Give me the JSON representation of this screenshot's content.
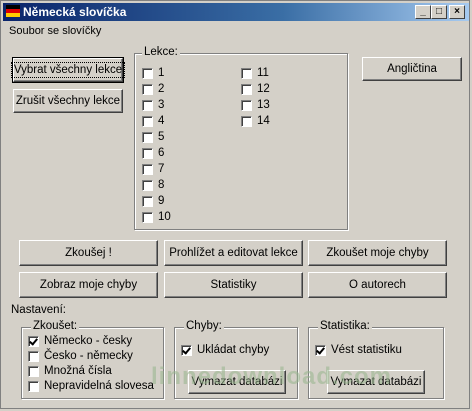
{
  "window": {
    "title": "Německá slovíčka"
  },
  "titlebar_buttons": {
    "minimize": "_",
    "maximize": "□",
    "close": "×"
  },
  "menu": {
    "file": "Soubor se slovíčky"
  },
  "left_buttons": {
    "select_all": "Vybrat všechny lekce",
    "cancel_all": "Zrušit všechny lekce"
  },
  "language_button": "Angličtina",
  "lessons": {
    "label": "Lekce:",
    "col1": [
      "1",
      "2",
      "3",
      "4",
      "5",
      "6",
      "7",
      "8",
      "9",
      "10"
    ],
    "col2": [
      "11",
      "12",
      "13",
      "14"
    ]
  },
  "actions": {
    "test": "Zkoušej !",
    "browse": "Prohlížet a editovat lekce",
    "test_mistakes": "Zkoušet moje chyby",
    "show_mistakes": "Zobraz moje chyby",
    "statistics": "Statistiky",
    "about": "O autorech"
  },
  "settings": {
    "label": "Nastavení:",
    "test_group": {
      "label": "Zkoušet:",
      "options": [
        {
          "label": "Německo - česky",
          "checked": true
        },
        {
          "label": "Česko - německy",
          "checked": false
        },
        {
          "label": "Množná čísla",
          "checked": false
        },
        {
          "label": "Nepravidelná slovesa",
          "checked": false
        }
      ]
    },
    "errors_group": {
      "label": "Chyby:",
      "save_label": "Ukládat chyby",
      "delete_label": "Vymazat databázi"
    },
    "stats_group": {
      "label": "Statistika:",
      "keep_label": "Vést statistiku",
      "delete_label": "Vymazat databázi"
    }
  },
  "watermark": "linnedownload.com"
}
